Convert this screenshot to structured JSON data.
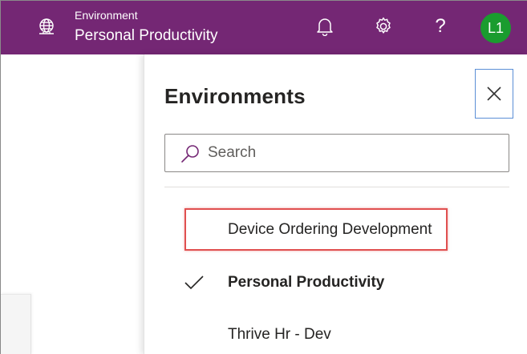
{
  "header": {
    "environment_label": "Environment",
    "environment_name": "Personal Productivity",
    "help_glyph": "?",
    "avatar_initials": "L1",
    "background_color": "#742774",
    "avatar_color": "#1a9c2f",
    "icons": [
      "globe-icon",
      "bell-icon",
      "gear-icon",
      "help-icon"
    ]
  },
  "panel": {
    "title": "Environments",
    "search_placeholder": "Search",
    "search_value": "",
    "items": [
      {
        "label": "Device Ordering Development",
        "selected": false,
        "highlighted": true
      },
      {
        "label": "Personal Productivity",
        "selected": true,
        "highlighted": false
      },
      {
        "label": "Thrive Hr - Dev",
        "selected": false,
        "highlighted": false
      }
    ],
    "highlight_color": "#e05050"
  }
}
